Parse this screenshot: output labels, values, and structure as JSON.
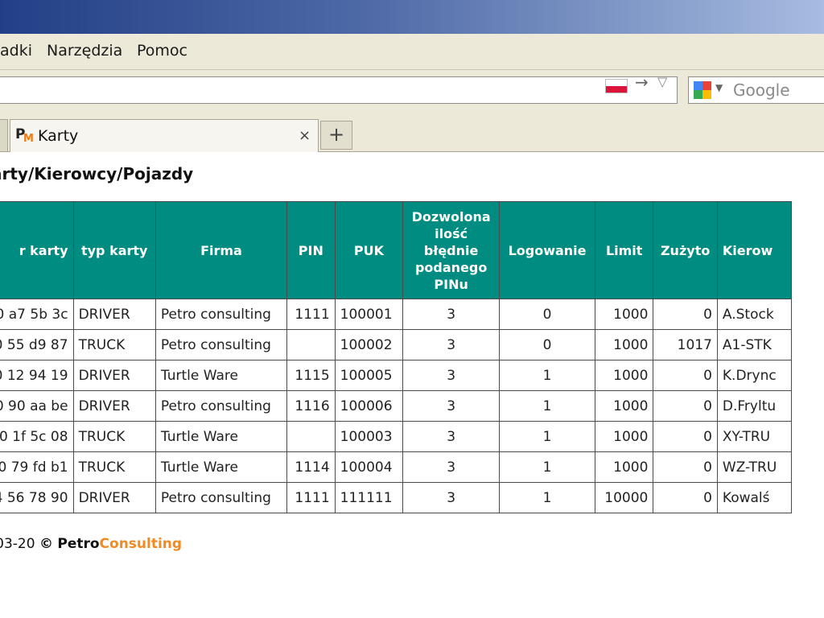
{
  "menu": {
    "items": [
      "adki",
      "Narzędzia",
      "Pomoc"
    ]
  },
  "search": {
    "placeholder": "Google"
  },
  "tab": {
    "title": "Karty",
    "favicon_letters": [
      "P",
      "M"
    ],
    "close_label": "×",
    "new_tab_label": "+"
  },
  "page": {
    "title": "arty/Kierowcy/Pojazdy"
  },
  "table": {
    "headers": [
      "r karty",
      "typ karty",
      "Firma",
      "PIN",
      "PUK",
      "Dozwolona ilość błędnie podanego PINu",
      "Logowanie",
      "Limit",
      "Zużyto",
      "Kierow"
    ],
    "rows": [
      [
        "0 a7 5b 3c",
        "DRIVER",
        "Petro consulting",
        "1111",
        "100001",
        "3",
        "0",
        "1000",
        "0",
        "A.Stock"
      ],
      [
        "0 55 d9 87",
        "TRUCK",
        "Petro consulting",
        "",
        "100002",
        "3",
        "0",
        "1000",
        "1017",
        "A1-STK"
      ],
      [
        "0 12 94 19",
        "DRIVER",
        "Turtle Ware",
        "1115",
        "100005",
        "3",
        "1",
        "1000",
        "0",
        "K.Drync"
      ],
      [
        "0 90 aa be",
        "DRIVER",
        "Petro consulting",
        "1116",
        "100006",
        "3",
        "1",
        "1000",
        "0",
        "D.Fryltu"
      ],
      [
        "0 1f 5c 08",
        "TRUCK",
        "Turtle Ware",
        "",
        "100003",
        "3",
        "1",
        "1000",
        "0",
        "XY-TRU"
      ],
      [
        "0 79 fd b1",
        "TRUCK",
        "Turtle Ware",
        "1114",
        "100004",
        "3",
        "1",
        "1000",
        "0",
        "WZ-TRU"
      ],
      [
        "4 56 78 90",
        "DRIVER",
        "Petro consulting",
        "1111",
        "111111",
        "3",
        "1",
        "10000",
        "0",
        "Kowalś"
      ]
    ]
  },
  "footer": {
    "date": "-03-20",
    "copyright": "©",
    "brand_part1": "Petro",
    "brand_part2": "Consulting"
  },
  "colors": {
    "header_bg": "#008c80",
    "brand_orange": "#ef8a24"
  }
}
